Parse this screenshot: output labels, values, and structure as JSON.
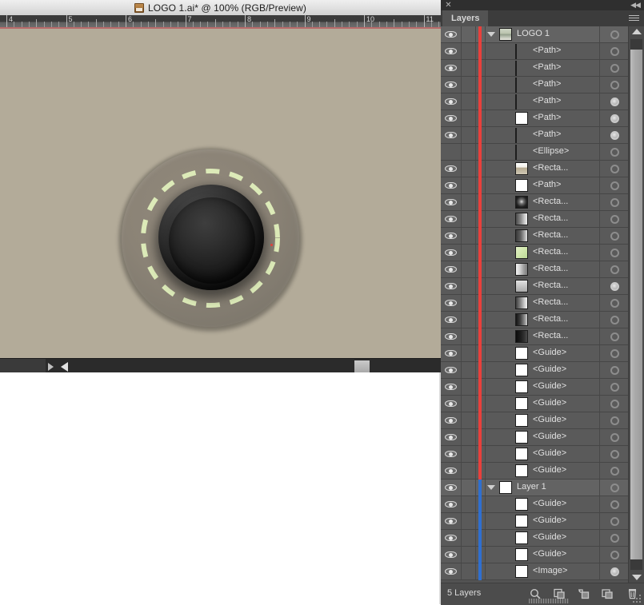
{
  "document": {
    "title": "LOGO 1.ai* @ 100% (RGB/Preview)",
    "icon": "illustrator-document-icon",
    "zoom": "100%",
    "color_mode": "RGB",
    "view_mode": "Preview",
    "canvas_background": "#b3ab99",
    "ruler": {
      "unit_labels": [
        "4",
        "5",
        "6",
        "7",
        "8",
        "9",
        "10",
        "11"
      ],
      "origin_label": "4"
    },
    "artwork": {
      "name": "logo-artwork",
      "outer_ring_color": "#8b8376",
      "dashed_circle_color": "#d8e8b4",
      "inner_sphere_color": "#1a1a1a",
      "anchor_point_color": "#e0423a"
    },
    "scrollbar": {
      "left_arrow": "◀",
      "right_arrow": "▶"
    }
  },
  "panel": {
    "title": "Layers",
    "close_label": "✕",
    "collapse_label": "◀◀",
    "menu_label": "panel-menu",
    "footer": {
      "count_label": "5 Layers",
      "buttons": [
        {
          "name": "locate-object-button",
          "label": "Locate Object"
        },
        {
          "name": "clipping-mask-button",
          "label": "Make/Release Clipping Mask"
        },
        {
          "name": "new-sublayer-button",
          "label": "Create New Sublayer"
        },
        {
          "name": "new-layer-button",
          "label": "Create New Layer"
        },
        {
          "name": "delete-selection-button",
          "label": "Delete Selection"
        }
      ]
    },
    "rows": [
      {
        "label": "LOGO 1",
        "indent": 0,
        "visible": true,
        "disclosure": true,
        "color": "red",
        "thumb": "layer-group",
        "target_filled": false,
        "selected_row": true
      },
      {
        "label": "<Path>",
        "indent": 1,
        "visible": true,
        "disclosure": false,
        "color": "red",
        "thumb": "sphere-dark",
        "target_filled": false,
        "selected_row": false
      },
      {
        "label": "<Path>",
        "indent": 1,
        "visible": true,
        "disclosure": false,
        "color": "red",
        "thumb": "sphere-dark2",
        "target_filled": false,
        "selected_row": false
      },
      {
        "label": "<Path>",
        "indent": 1,
        "visible": true,
        "disclosure": false,
        "color": "red",
        "thumb": "sphere-dark3",
        "target_filled": false,
        "selected_row": false
      },
      {
        "label": "<Path>",
        "indent": 1,
        "visible": true,
        "disclosure": false,
        "color": "red",
        "thumb": "sphere-light",
        "target_filled": true,
        "selected_row": false
      },
      {
        "label": "<Path>",
        "indent": 1,
        "visible": true,
        "disclosure": false,
        "color": "red",
        "thumb": "white",
        "target_filled": true,
        "selected_row": false
      },
      {
        "label": "<Path>",
        "indent": 1,
        "visible": true,
        "disclosure": false,
        "color": "red",
        "thumb": "circle-gray",
        "target_filled": true,
        "selected_row": false
      },
      {
        "label": "<Ellipse>",
        "indent": 1,
        "visible": false,
        "disclosure": false,
        "color": "red",
        "thumb": "sphere-black",
        "target_filled": false,
        "selected_row": false
      },
      {
        "label": "<Recta...",
        "indent": 1,
        "visible": true,
        "disclosure": false,
        "color": "red",
        "thumb": "rect-tan",
        "target_filled": false,
        "selected_row": false
      },
      {
        "label": "<Path>",
        "indent": 1,
        "visible": true,
        "disclosure": false,
        "color": "red",
        "thumb": "white",
        "target_filled": false,
        "selected_row": false
      },
      {
        "label": "<Recta...",
        "indent": 1,
        "visible": true,
        "disclosure": false,
        "color": "red",
        "thumb": "rect-glow",
        "target_filled": false,
        "selected_row": false
      },
      {
        "label": "<Recta...",
        "indent": 1,
        "visible": true,
        "disclosure": false,
        "color": "red",
        "thumb": "rect-grad1",
        "target_filled": false,
        "selected_row": false
      },
      {
        "label": "<Recta...",
        "indent": 1,
        "visible": true,
        "disclosure": false,
        "color": "red",
        "thumb": "rect-grad2",
        "target_filled": false,
        "selected_row": false
      },
      {
        "label": "<Recta...",
        "indent": 1,
        "visible": true,
        "disclosure": false,
        "color": "red",
        "thumb": "rect-green",
        "target_filled": false,
        "selected_row": false
      },
      {
        "label": "<Recta...",
        "indent": 1,
        "visible": true,
        "disclosure": false,
        "color": "red",
        "thumb": "rect-grad3",
        "target_filled": false,
        "selected_row": false
      },
      {
        "label": "<Recta...",
        "indent": 1,
        "visible": true,
        "disclosure": false,
        "color": "red",
        "thumb": "rect-gray",
        "target_filled": true,
        "selected_row": false
      },
      {
        "label": "<Recta...",
        "indent": 1,
        "visible": true,
        "disclosure": false,
        "color": "red",
        "thumb": "rect-grad4",
        "target_filled": false,
        "selected_row": false
      },
      {
        "label": "<Recta...",
        "indent": 1,
        "visible": true,
        "disclosure": false,
        "color": "red",
        "thumb": "rect-grad5",
        "target_filled": false,
        "selected_row": false
      },
      {
        "label": "<Recta...",
        "indent": 1,
        "visible": true,
        "disclosure": false,
        "color": "red",
        "thumb": "rect-dark",
        "target_filled": false,
        "selected_row": false
      },
      {
        "label": "<Guide>",
        "indent": 1,
        "visible": true,
        "disclosure": false,
        "color": "red",
        "thumb": "white",
        "target_filled": false,
        "selected_row": false
      },
      {
        "label": "<Guide>",
        "indent": 1,
        "visible": true,
        "disclosure": false,
        "color": "red",
        "thumb": "white",
        "target_filled": false,
        "selected_row": false
      },
      {
        "label": "<Guide>",
        "indent": 1,
        "visible": true,
        "disclosure": false,
        "color": "red",
        "thumb": "white",
        "target_filled": false,
        "selected_row": false
      },
      {
        "label": "<Guide>",
        "indent": 1,
        "visible": true,
        "disclosure": false,
        "color": "red",
        "thumb": "white",
        "target_filled": false,
        "selected_row": false
      },
      {
        "label": "<Guide>",
        "indent": 1,
        "visible": true,
        "disclosure": false,
        "color": "red",
        "thumb": "white",
        "target_filled": false,
        "selected_row": false
      },
      {
        "label": "<Guide>",
        "indent": 1,
        "visible": true,
        "disclosure": false,
        "color": "red",
        "thumb": "white",
        "target_filled": false,
        "selected_row": false
      },
      {
        "label": "<Guide>",
        "indent": 1,
        "visible": true,
        "disclosure": false,
        "color": "red",
        "thumb": "white",
        "target_filled": false,
        "selected_row": false
      },
      {
        "label": "<Guide>",
        "indent": 1,
        "visible": true,
        "disclosure": false,
        "color": "red",
        "thumb": "white",
        "target_filled": false,
        "selected_row": false
      },
      {
        "label": "Layer 1",
        "indent": 0,
        "visible": true,
        "disclosure": true,
        "color": "blue",
        "thumb": "white",
        "target_filled": false,
        "selected_row": true
      },
      {
        "label": "<Guide>",
        "indent": 1,
        "visible": true,
        "disclosure": false,
        "color": "blue",
        "thumb": "white",
        "target_filled": false,
        "selected_row": false
      },
      {
        "label": "<Guide>",
        "indent": 1,
        "visible": true,
        "disclosure": false,
        "color": "blue",
        "thumb": "white",
        "target_filled": false,
        "selected_row": false
      },
      {
        "label": "<Guide>",
        "indent": 1,
        "visible": true,
        "disclosure": false,
        "color": "blue",
        "thumb": "white",
        "target_filled": false,
        "selected_row": false
      },
      {
        "label": "<Guide>",
        "indent": 1,
        "visible": true,
        "disclosure": false,
        "color": "blue",
        "thumb": "white",
        "target_filled": false,
        "selected_row": false
      },
      {
        "label": "<Image>",
        "indent": 1,
        "visible": true,
        "disclosure": false,
        "color": "blue",
        "thumb": "white",
        "target_filled": true,
        "selected_row": false
      }
    ]
  }
}
